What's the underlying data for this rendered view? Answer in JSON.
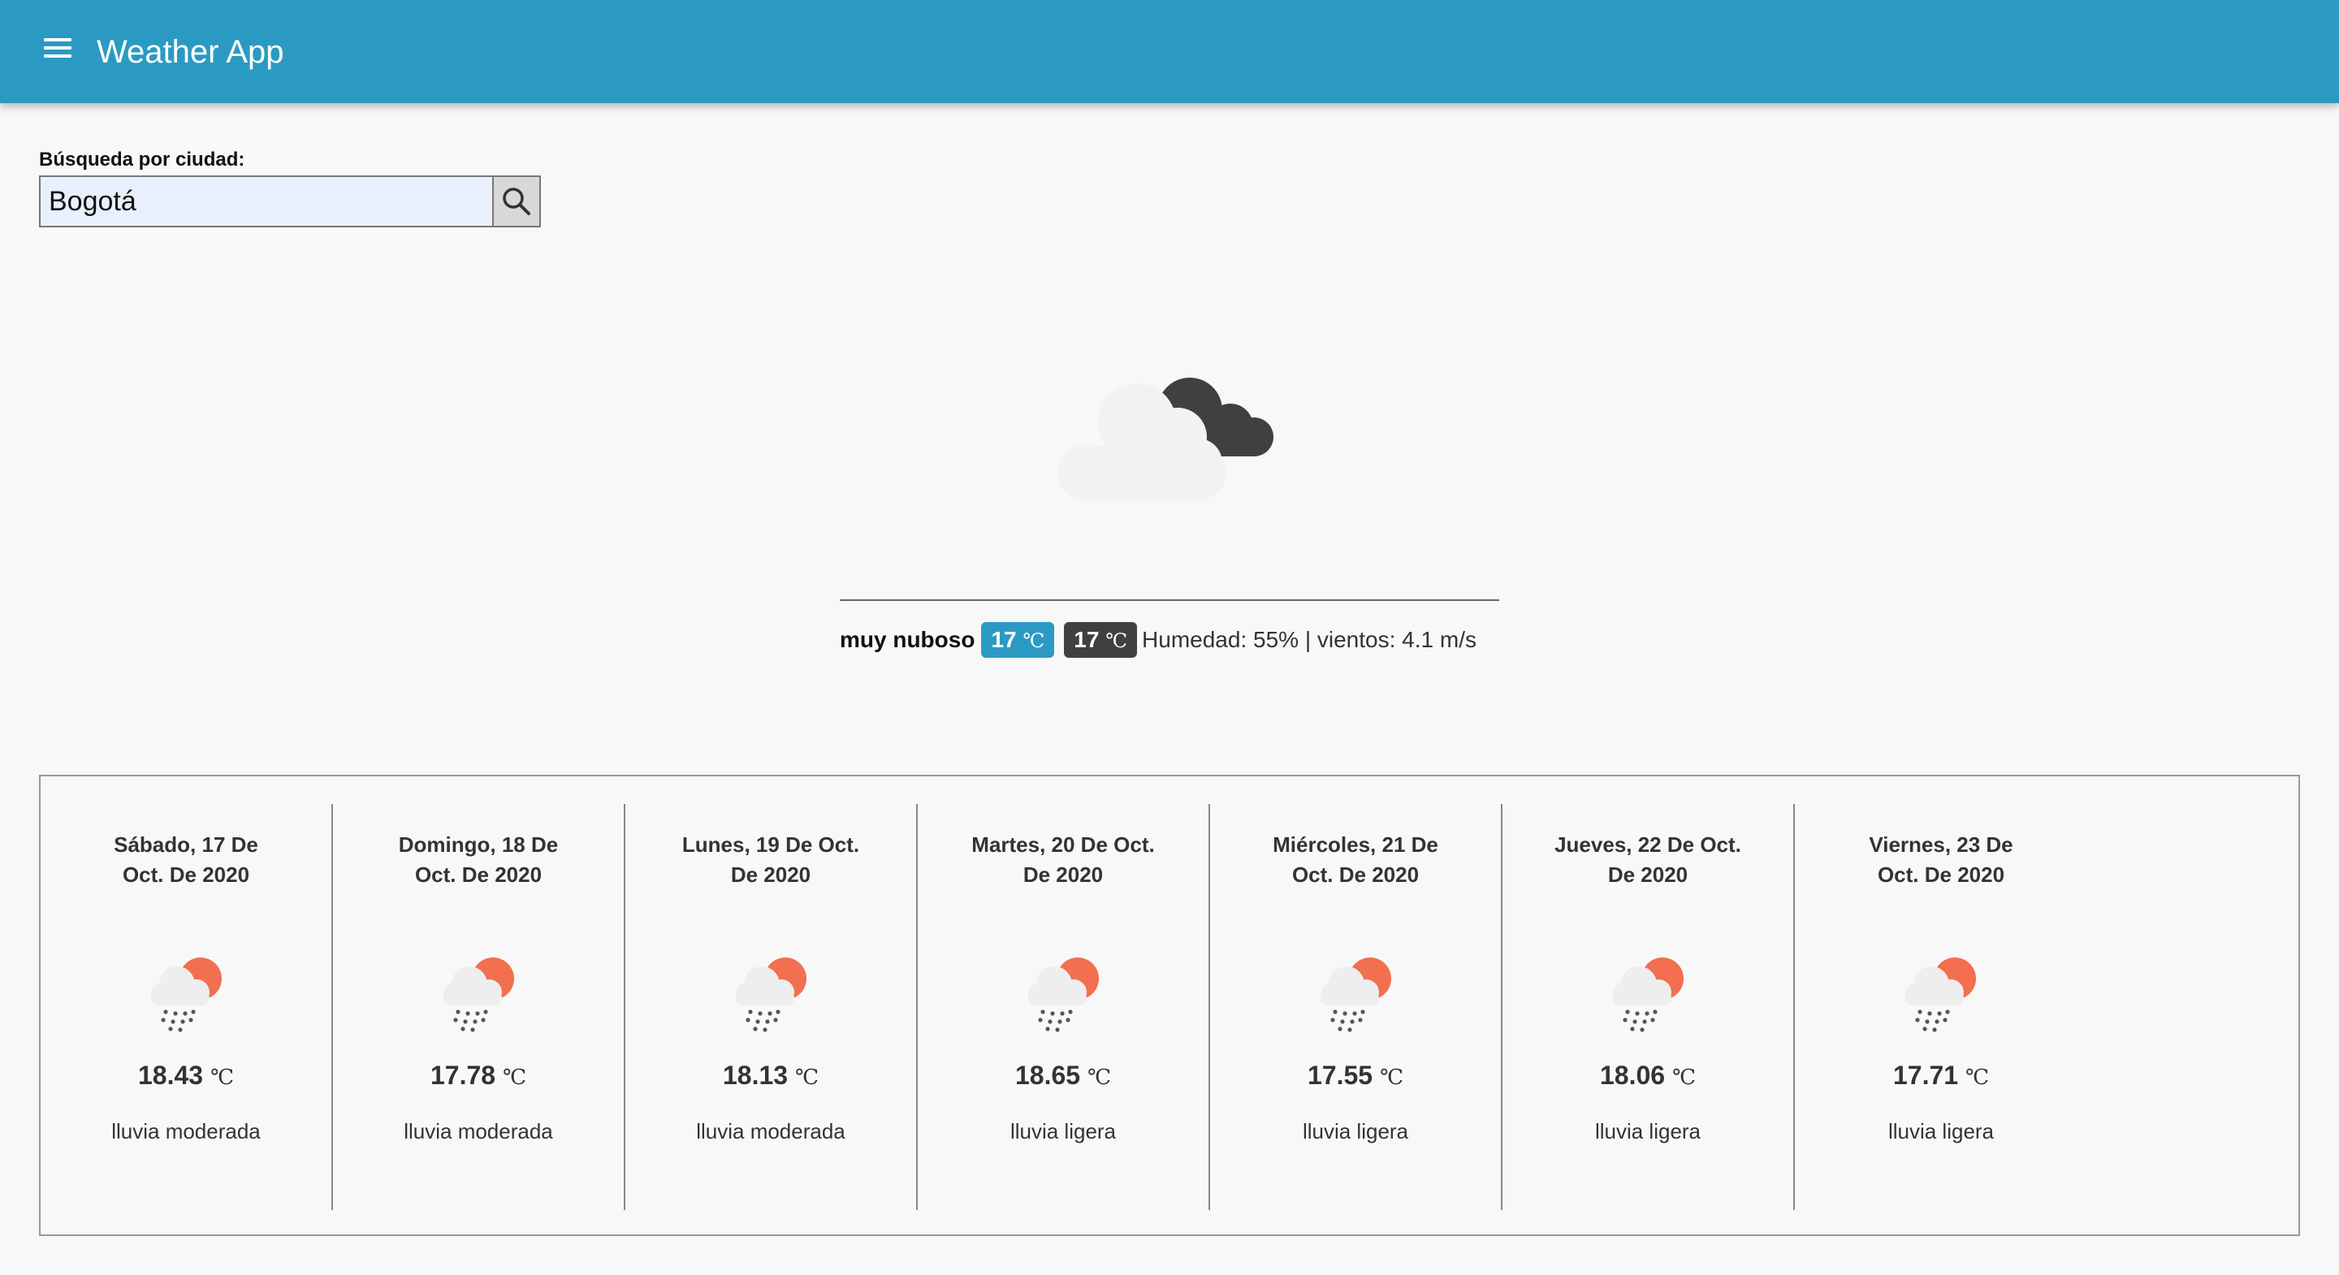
{
  "app": {
    "title": "Weather App",
    "menu_icon": "hamburger-menu-icon"
  },
  "search": {
    "label": "Búsqueda por ciudad:",
    "value": "Bogotá",
    "button_icon": "search-icon"
  },
  "current": {
    "icon": "overcast-clouds-icon",
    "condition": "muy nuboso",
    "temp_badge_1": "17",
    "temp_badge_2": "17",
    "unit": "℃",
    "humidity_wind": "Humedad: 55% | vientos: 4.1 m/s"
  },
  "forecast": [
    {
      "date_line1": "Sábado, 17 De",
      "date_line2": "Oct. De 2020",
      "temp": "18.43",
      "unit": "℃",
      "desc": "lluvia moderada",
      "icon": "rain-sun-icon"
    },
    {
      "date_line1": "Domingo, 18 De",
      "date_line2": "Oct. De 2020",
      "temp": "17.78",
      "unit": "℃",
      "desc": "lluvia moderada",
      "icon": "rain-sun-icon"
    },
    {
      "date_line1": "Lunes, 19 De Oct.",
      "date_line2": "De 2020",
      "temp": "18.13",
      "unit": "℃",
      "desc": "lluvia moderada",
      "icon": "rain-sun-icon"
    },
    {
      "date_line1": "Martes, 20 De Oct.",
      "date_line2": "De 2020",
      "temp": "18.65",
      "unit": "℃",
      "desc": "lluvia ligera",
      "icon": "rain-sun-icon"
    },
    {
      "date_line1": "Miércoles, 21 De",
      "date_line2": "Oct. De 2020",
      "temp": "17.55",
      "unit": "℃",
      "desc": "lluvia ligera",
      "icon": "rain-sun-icon"
    },
    {
      "date_line1": "Jueves, 22 De Oct.",
      "date_line2": "De 2020",
      "temp": "18.06",
      "unit": "℃",
      "desc": "lluvia ligera",
      "icon": "rain-sun-icon"
    },
    {
      "date_line1": "Viernes, 23 De",
      "date_line2": "Oct. De 2020",
      "temp": "17.71",
      "unit": "℃",
      "desc": "lluvia ligera",
      "icon": "rain-sun-icon"
    }
  ],
  "colors": {
    "primary": "#2b9ac2",
    "dark_badge": "#404040",
    "sun": "#f26f4f",
    "background": "#f8f8f8"
  }
}
